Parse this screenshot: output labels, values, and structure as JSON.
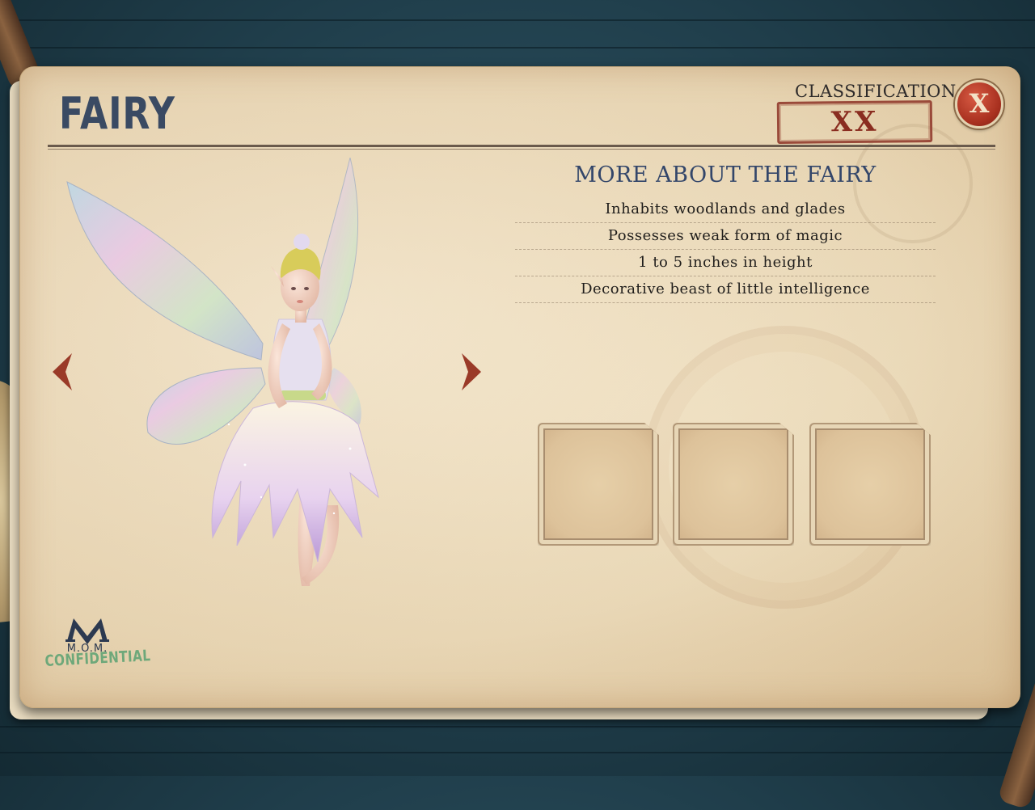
{
  "creature": {
    "name": "FAIRY",
    "classification_label": "CLASSIFICATION:",
    "classification_value": "XX",
    "close_label": "X"
  },
  "info": {
    "heading": "MORE ABOUT THE FAIRY",
    "facts": [
      "Inhabits woodlands and glades",
      "Possesses weak form of magic",
      "1 to 5 inches in height",
      "Decorative beast of little intelligence"
    ]
  },
  "logo": {
    "abbreviation": "M.O.M.",
    "stamp": "CONFIDENTIAL"
  },
  "icons": {
    "prev": "chevron-left-icon",
    "next": "chevron-right-icon",
    "close": "close-icon"
  },
  "colors": {
    "title": "#3a4a63",
    "stamp": "#9a4a3a",
    "close_button": "#b8392a",
    "confidential": "#6ea87a",
    "background": "#1f3d4a"
  }
}
